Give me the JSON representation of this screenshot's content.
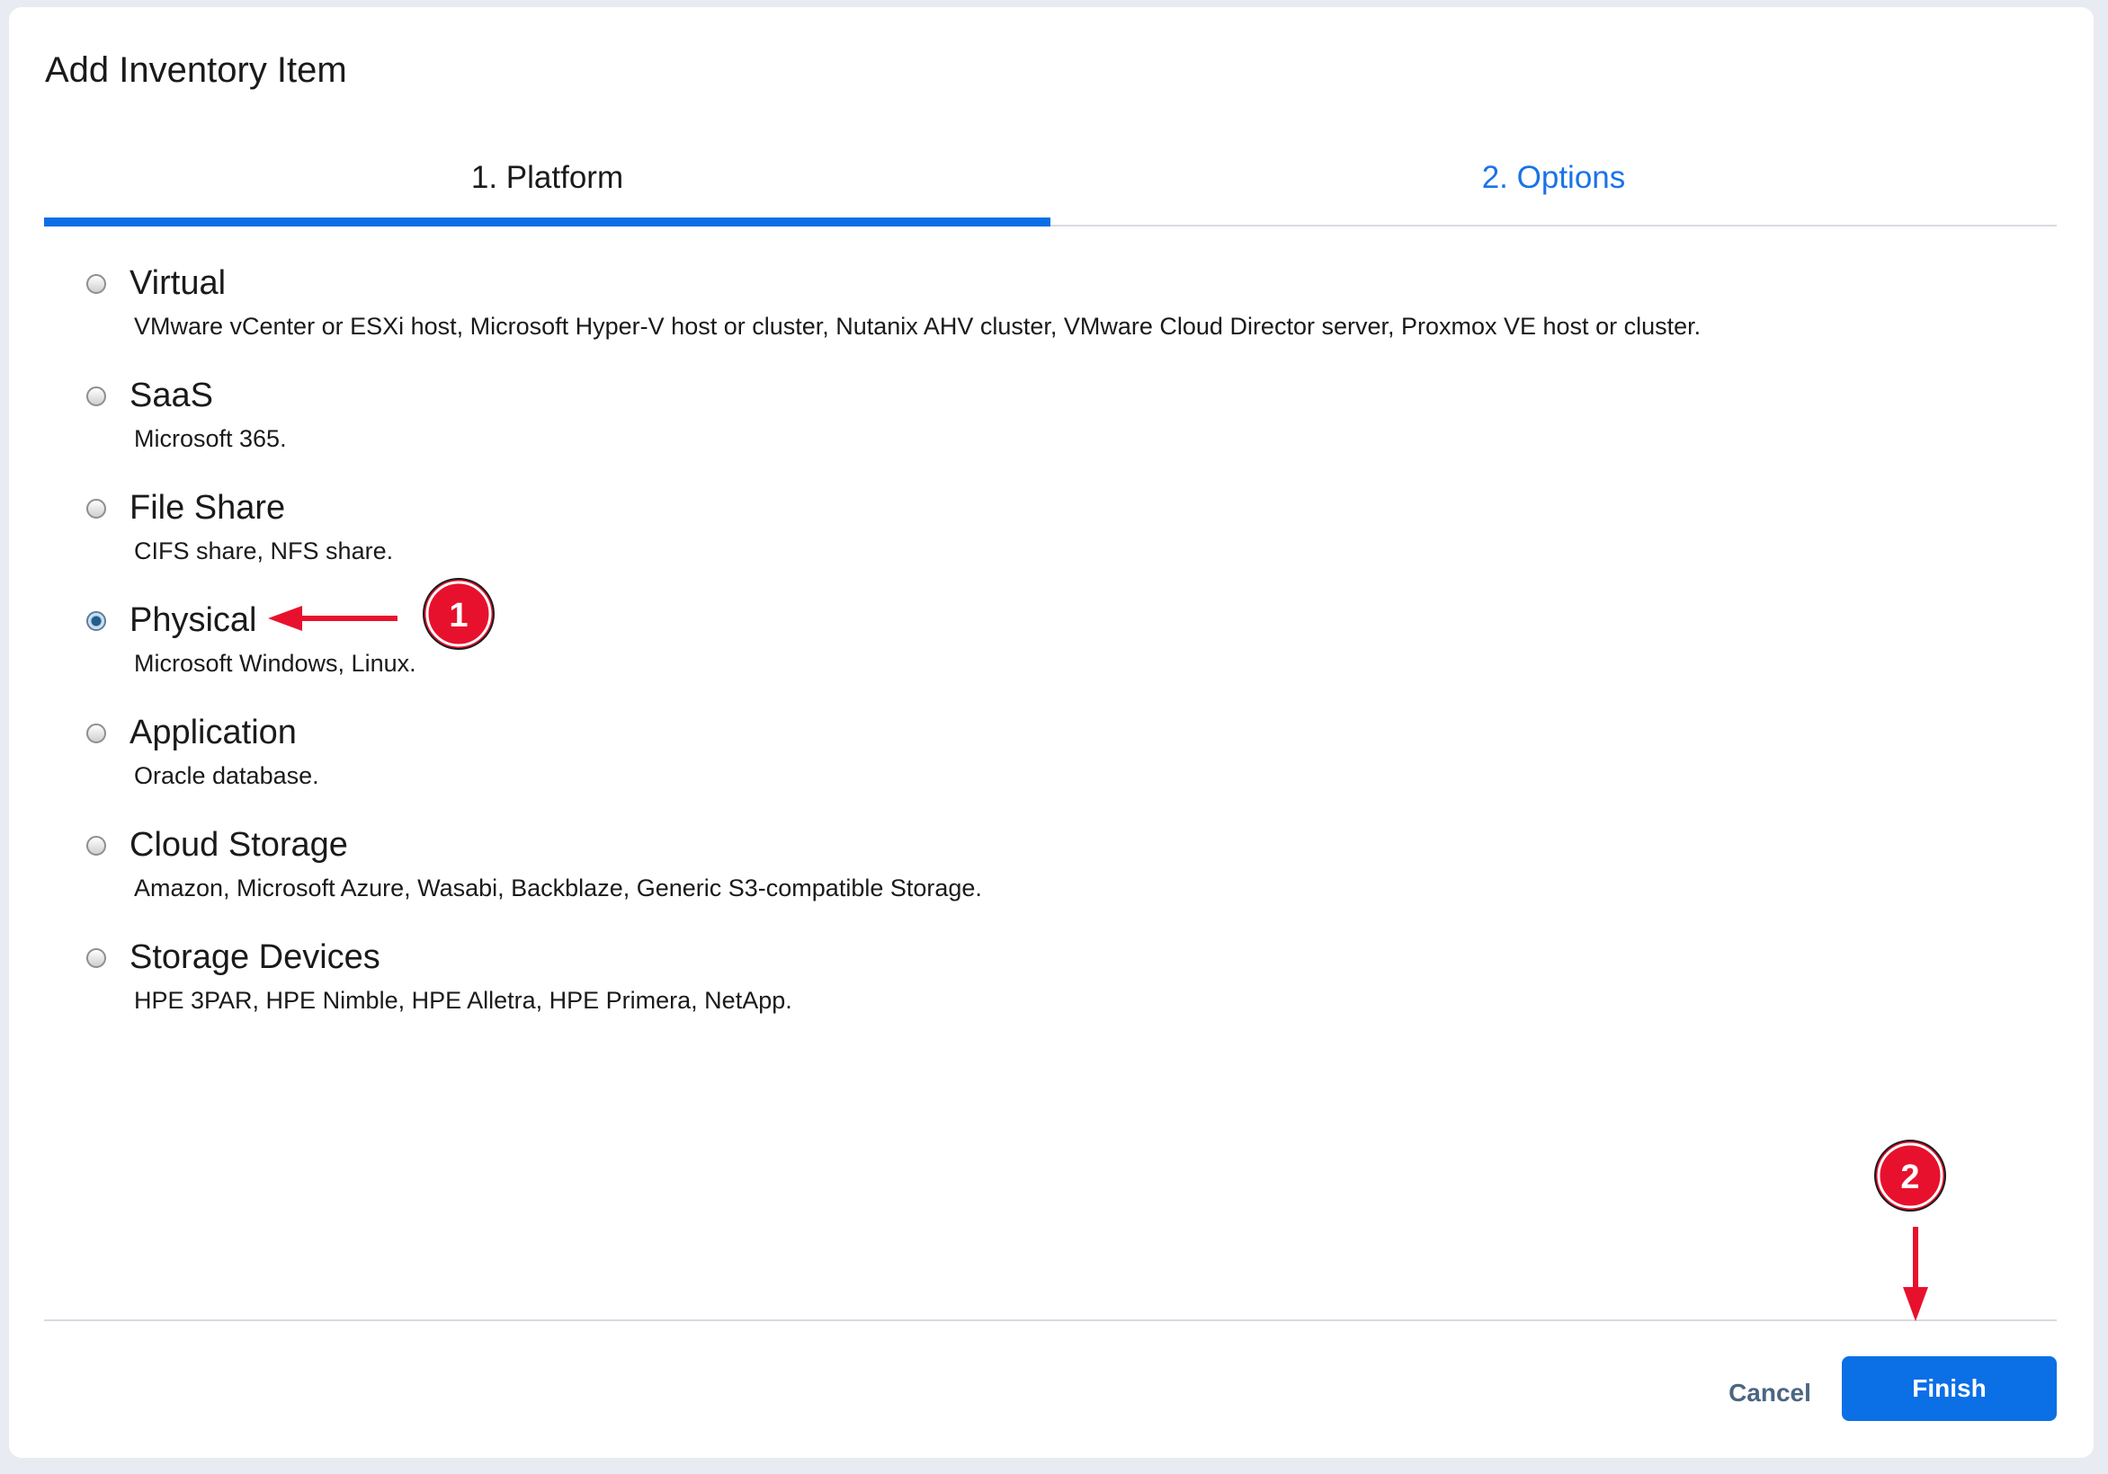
{
  "dialog": {
    "title": "Add Inventory Item"
  },
  "tabs": [
    {
      "label": "1. Platform",
      "active": true
    },
    {
      "label": "2. Options",
      "active": false
    }
  ],
  "platform_options": [
    {
      "label": "Virtual",
      "description": "VMware vCenter or ESXi host, Microsoft Hyper-V host or cluster, Nutanix AHV cluster, VMware Cloud Director server, Proxmox VE host or cluster.",
      "selected": false
    },
    {
      "label": "SaaS",
      "description": "Microsoft 365.",
      "selected": false
    },
    {
      "label": "File Share",
      "description": "CIFS share, NFS share.",
      "selected": false
    },
    {
      "label": "Physical",
      "description": "Microsoft Windows, Linux.",
      "selected": true
    },
    {
      "label": "Application",
      "description": "Oracle database.",
      "selected": false
    },
    {
      "label": "Cloud Storage",
      "description": "Amazon, Microsoft Azure, Wasabi, Backblaze, Generic S3-compatible Storage.",
      "selected": false
    },
    {
      "label": "Storage Devices",
      "description": "HPE 3PAR, HPE Nimble, HPE Alletra, HPE Primera, NetApp.",
      "selected": false
    }
  ],
  "footer": {
    "cancel_label": "Cancel",
    "finish_label": "Finish"
  },
  "annotations": {
    "step1": "1",
    "step2": "2",
    "color": "#e8112d"
  },
  "colors": {
    "accent": "#0b6fe6",
    "tab_inactive_text": "#1a73e8",
    "cancel_text": "#4b6683"
  }
}
